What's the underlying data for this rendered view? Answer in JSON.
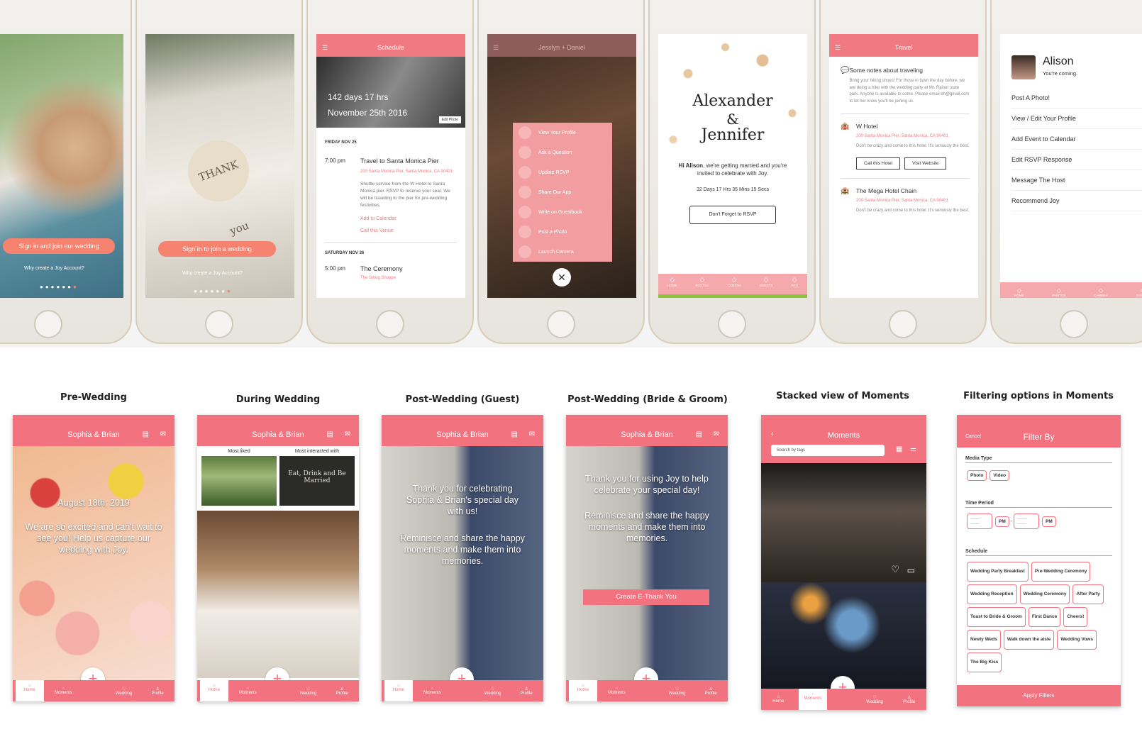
{
  "phones": {
    "p1": {
      "cta": "Sign in and join our wedding",
      "link": "Why create a Joy Account?"
    },
    "p2": {
      "card_text": "THANK you",
      "cta": "Sign in to join a wedding",
      "link": "Why create a Joy Account?"
    },
    "p3": {
      "title": "Schedule",
      "countdown": "142 days 17 hrs",
      "date": "November 25th 2016",
      "edit": "Edit Photo",
      "day1": "FRIDAY NOV 25",
      "e1_time": "7:00 pm",
      "e1_title": "Travel to Santa Monica Pier",
      "e1_addr": "200 Santa Monica Pier, Santa Monica, CA 90401",
      "e1_desc": "Shuttle service from the W Hotel to Santa Monica pier. RSVP to reserve your seat. We will be traveling to the pier for pre-wedding festivities.",
      "e1_link1": "Add to Calendar",
      "e1_link2": "Call this Venue",
      "day2": "SATURDAY NOV 26",
      "e2_time": "5:00 pm",
      "e2_title": "The Ceremony",
      "e2_addr": "The Smog Shoppe"
    },
    "p4": {
      "title": "Jesslyn + Daniel",
      "menu": [
        "View Your Profile",
        "Ask a Question",
        "Update RSVP",
        "Share Our App",
        "Write on Guestbook",
        "Post a Photo",
        "Launch Camera"
      ]
    },
    "p5": {
      "name1": "Alexander",
      "amp": "&",
      "name2": "Jennifer",
      "greet_name": "Hi Alison",
      "greet_rest": ", we're getting married and you're invited to celebrate with Joy.",
      "count": "32 Days   17 Hrs   35 Mins   15 Secs",
      "rsvp": "Don't Forget to RSVP",
      "tabs": [
        "HOME",
        "PHOTOS",
        "CAMERA",
        "GUESTS",
        "YOU"
      ]
    },
    "p6": {
      "title": "Travel",
      "note_title": "Some notes about traveling",
      "note_body": "Bring your hiking shoes! For those in town the day before, we are doing a hike with the wedding party at Mt. Rainer state park. Anyone is available to come. Please email bh@gmail.com to let her know you'll be joining us.",
      "h1": "W Hotel",
      "h1_addr": "200 Santa Monica Pier, Santa Monica, CA 90401",
      "h1_desc": "Don't be crazy and come to this hotel. It's seriously the best.",
      "btn1": "Call this Hotel",
      "btn2": "Visit Website",
      "h2": "The Mega Hotel Chain",
      "h2_addr": "200 Santa Monica Pier, Santa Monica, CA 90401",
      "h2_desc": "Don't be crazy and come to this hotel. It's seriously the best."
    },
    "p7": {
      "name": "Alison",
      "status": "You're coming.",
      "menu": [
        "Post A Photo!",
        "View / Edit Your Profile",
        "Add Event to Calendar",
        "Edit RSVP Response",
        "Message The Host",
        "Recommend Joy"
      ],
      "tabs": [
        "HOME",
        "PHOTOS",
        "CAMERA",
        "GUESTS"
      ]
    }
  },
  "headings": [
    "Pre-Wedding",
    "During Wedding",
    "Post-Wedding (Guest)",
    "Post-Wedding (Bride & Groom)",
    "Stacked view of Moments",
    "Filtering options in Moments"
  ],
  "couple": "Sophia & Brian",
  "tabs": {
    "home": "Home",
    "moments": "Moments",
    "wedding": "Wedding",
    "profile": "Profile"
  },
  "c1": {
    "date": "August 18th, 2019",
    "msg": "We are so excited and can't wait to see you! Help us capture our wedding with Joy."
  },
  "c2": {
    "most_liked": "Most liked",
    "most_interacted": "Most interacted with",
    "sign": "Eat, Drink and Be Married"
  },
  "c3": {
    "msg1": "Thank you for celebrating Sophia & Brian's special day with us!",
    "msg2": "Reminisce and share the happy moments and make them into memories."
  },
  "c4": {
    "msg1": "Thank you for using Joy to help celebrate your special day!",
    "msg2": "Reminisce and share the happy moments and make them into memories.",
    "cta": "Create E-Thank You"
  },
  "c5": {
    "title": "Moments",
    "search_placeholder": "Search by tags"
  },
  "c6": {
    "cancel": "Cancel",
    "title": "Filter By",
    "media_label": "Media Type",
    "media": [
      "Photo",
      "Video"
    ],
    "time_label": "Time Period",
    "pm": "PM",
    "dash": "-",
    "time_blank": "—— ——",
    "schedule_label": "Schedule",
    "schedule": [
      "Wedding Party Breakfast",
      "Pre-Wedding Ceremony",
      "Wedding Reception",
      "Wedding Ceremony",
      "After Party",
      "Toast to Bride & Groom",
      "First Dance",
      "Cheers!",
      "Newly Weds",
      "Walk down the aisle",
      "Wedding Vows",
      "The Big Kiss"
    ],
    "apply": "Apply Filters"
  }
}
